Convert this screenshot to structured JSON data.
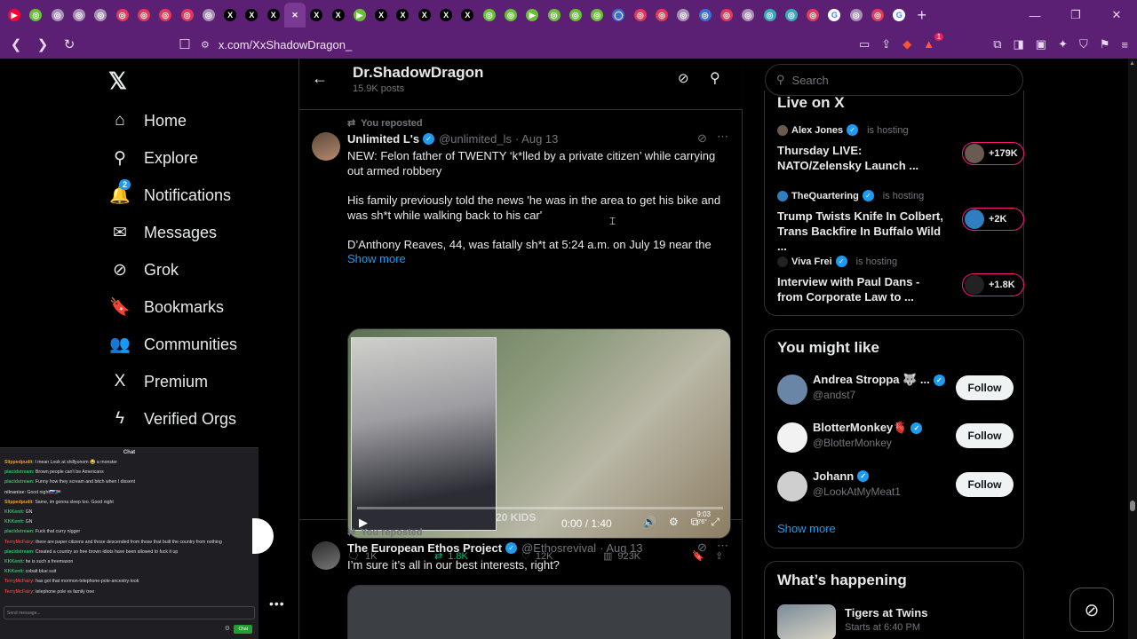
{
  "browser": {
    "tab_favicons": [
      {
        "icon": "youtube-icon",
        "color": "#ff0033",
        "glyph": "▶"
      },
      {
        "icon": "chromium-green-icon",
        "color": "#6abf38",
        "glyph": "◎"
      },
      {
        "icon": "site-gray-icon",
        "color": "#a890b4",
        "glyph": "◎"
      },
      {
        "icon": "site-gray-icon",
        "color": "#a890b4",
        "glyph": "◎"
      },
      {
        "icon": "site-gray-icon",
        "color": "#a890b4",
        "glyph": "◎"
      },
      {
        "icon": "site-red-icon",
        "color": "#e03a5a",
        "glyph": "◎"
      },
      {
        "icon": "site-red-icon",
        "color": "#e03a5a",
        "glyph": "◎"
      },
      {
        "icon": "site-red-icon",
        "color": "#e03a5a",
        "glyph": "◎"
      },
      {
        "icon": "site-red-icon",
        "color": "#e03a5a",
        "glyph": "◎"
      },
      {
        "icon": "site-gray-icon",
        "color": "#a890b4",
        "glyph": "◎"
      },
      {
        "icon": "x-icon",
        "color": "#000000",
        "glyph": "X"
      },
      {
        "icon": "x-icon",
        "color": "#000000",
        "glyph": "X"
      },
      {
        "icon": "x-icon",
        "color": "#000000",
        "glyph": "X"
      },
      {
        "icon": "close-tab-icon",
        "color": "#7a3a93",
        "glyph": "✕"
      },
      {
        "icon": "x-icon",
        "color": "#000000",
        "glyph": "X"
      },
      {
        "icon": "x-icon",
        "color": "#000000",
        "glyph": "X"
      },
      {
        "icon": "rumble-icon",
        "color": "#6abf38",
        "glyph": "▶"
      },
      {
        "icon": "x-icon",
        "color": "#000000",
        "glyph": "X"
      },
      {
        "icon": "x-icon",
        "color": "#000000",
        "glyph": "X"
      },
      {
        "icon": "x-icon",
        "color": "#000000",
        "glyph": "X"
      },
      {
        "icon": "x-icon",
        "color": "#000000",
        "glyph": "X"
      },
      {
        "icon": "x-icon",
        "color": "#000000",
        "glyph": "X"
      },
      {
        "icon": "chromium-green-icon",
        "color": "#6abf38",
        "glyph": "◎"
      },
      {
        "icon": "chromium-green-icon",
        "color": "#6abf38",
        "glyph": "◎"
      },
      {
        "icon": "rumble-icon",
        "color": "#6abf38",
        "glyph": "▶"
      },
      {
        "icon": "chromium-green-icon",
        "color": "#6abf38",
        "glyph": "◎"
      },
      {
        "icon": "chromium-green-icon",
        "color": "#6abf38",
        "glyph": "◎"
      },
      {
        "icon": "chromium-green-icon",
        "color": "#6abf38",
        "glyph": "◎"
      },
      {
        "icon": "site-blue-icon",
        "color": "#3b6fd8",
        "glyph": "◯"
      },
      {
        "icon": "site-red-icon",
        "color": "#e03a5a",
        "glyph": "◎"
      },
      {
        "icon": "site-red-icon",
        "color": "#e03a5a",
        "glyph": "◎"
      },
      {
        "icon": "site-gray-icon",
        "color": "#a890b4",
        "glyph": "◎"
      },
      {
        "icon": "site-blue-icon",
        "color": "#3b6fd8",
        "glyph": "◎"
      },
      {
        "icon": "site-red-icon",
        "color": "#e03a5a",
        "glyph": "◎"
      },
      {
        "icon": "site-gray-icon",
        "color": "#a890b4",
        "glyph": "◎"
      },
      {
        "icon": "site-teal-icon",
        "color": "#3aa8b8",
        "glyph": "◎"
      },
      {
        "icon": "site-teal-icon",
        "color": "#3aa8b8",
        "glyph": "◎"
      },
      {
        "icon": "site-red-icon",
        "color": "#e03a5a",
        "glyph": "◎"
      },
      {
        "icon": "google-icon",
        "color": "#ffffff",
        "glyph": "G"
      },
      {
        "icon": "site-gray-icon",
        "color": "#a890b4",
        "glyph": "◎"
      },
      {
        "icon": "site-red-icon",
        "color": "#e03a5a",
        "glyph": "◎"
      },
      {
        "icon": "google-icon",
        "color": "#ffffff",
        "glyph": "G"
      }
    ],
    "active_tab_index": 13,
    "url": "x.com/XxShadowDragon_",
    "extension_count": "1"
  },
  "nav": {
    "items": [
      {
        "label": "Home",
        "icon": "home-icon",
        "glyph": "⌂"
      },
      {
        "label": "Explore",
        "icon": "search-icon",
        "glyph": "⚲"
      },
      {
        "label": "Notifications",
        "icon": "bell-icon",
        "glyph": "🔔"
      },
      {
        "label": "Messages",
        "icon": "mail-icon",
        "glyph": "✉"
      },
      {
        "label": "Grok",
        "icon": "grok-icon",
        "glyph": "⊘"
      },
      {
        "label": "Bookmarks",
        "icon": "bookmark-icon",
        "glyph": "🔖"
      },
      {
        "label": "Communities",
        "icon": "communities-icon",
        "glyph": "👥"
      },
      {
        "label": "Premium",
        "icon": "x-icon",
        "glyph": "X"
      },
      {
        "label": "Verified Orgs",
        "icon": "bolt-icon",
        "glyph": "ϟ"
      }
    ],
    "notification_count": "2"
  },
  "chat": {
    "title": "Chat",
    "lines": [
      {
        "user": "Slippedpudit",
        "color": "#e8a020",
        "text": "I mean Look at shillyonom 😂 a monster"
      },
      {
        "user": "placidstream",
        "color": "#22c55e",
        "text": "Brown people can't be Americans"
      },
      {
        "user": "placidstream",
        "color": "#22c55e",
        "text": "Funny how they scream and bitch when I dissent"
      },
      {
        "user": "nilnanise",
        "color": "#bbbbbb",
        "text": "Good night🇷🇺🇿🇦"
      },
      {
        "user": "Slippedpudit",
        "color": "#e8a020",
        "text": "Same, im gonna sleep too. Good night"
      },
      {
        "user": "KKKentt",
        "color": "#22c55e",
        "text": "GN"
      },
      {
        "user": "KKKentt",
        "color": "#22c55e",
        "text": "GN"
      },
      {
        "user": "placidstream",
        "color": "#22c55e",
        "text": "Fuck that curry nigger"
      },
      {
        "user": "TerryMcFairy",
        "color": "#e03a3a",
        "text": "there are paper citizens and those descended from those that built the country from nothing"
      },
      {
        "user": "placidstream",
        "color": "#22c55e",
        "text": "Created a country so free brown idiots have been allowed to fuck it up"
      },
      {
        "user": "KKKentt",
        "color": "#22c55e",
        "text": "he is such a freemason"
      },
      {
        "user": "KKKentt",
        "color": "#22c55e",
        "text": "cobalt blue suit"
      },
      {
        "user": "TerryMcFairy",
        "color": "#e03a3a",
        "text": "has got that mormon-telephone-pole-ancestry-look"
      },
      {
        "user": "TerryMcFairy",
        "color": "#e03a3a",
        "text": "telephone pole vs family tree"
      }
    ],
    "input_placeholder": "Send message...",
    "send_label": "Chat"
  },
  "profile_header": {
    "name": "Dr.ShadowDragon",
    "posts": "15.9K posts"
  },
  "tweets": [
    {
      "repost_label": "You reposted",
      "name": "Unlimited L's",
      "handle": "@unlimited_ls",
      "date": "· Aug 13",
      "text_blocks": [
        "NEW: Felon father of TWENTY ‘k*lled by a private citizen’ while carrying out armed robbery",
        "His family previously told the news 'he was in the area to get his bike and was sh*t while walking back to his car'",
        "D’Anthony Reaves, 44, was fatally sh*t at 5:24 a.m. on July 19 near the"
      ],
      "show_more": "Show more",
      "video": {
        "overlay_text": "20 KIDS",
        "time": "0:00 / 1:40",
        "clock": "9:03",
        "temp": "76°"
      },
      "actions": {
        "replies": "1K",
        "reposts": "1.8K",
        "likes": "12K",
        "views": "923K"
      }
    },
    {
      "repost_label": "You reposted",
      "name": "The European Ethos Project",
      "handle": "@Ethosrevival",
      "date": "· Aug 13",
      "text": "I’m sure it’s all in our best interests, right?"
    }
  ],
  "sidebar": {
    "search_placeholder": "Search",
    "live_title": "Live on X",
    "live": [
      {
        "host": "Alex Jones",
        "hosting": "is hosting",
        "title": "Thursday LIVE: NATO/Zelensky Launch ...",
        "count": "+179K"
      },
      {
        "host": "TheQuartering",
        "hosting": "is hosting",
        "title": "Trump Twists Knife In Colbert, Trans Backfire In Buffalo Wild ...",
        "count": "+2K"
      },
      {
        "host": "Viva Frei",
        "hosting": "is hosting",
        "title": "Interview with Paul Dans - from Corporate Law to ...",
        "count": "+1.8K"
      }
    ],
    "might_like_title": "You might like",
    "suggestions": [
      {
        "name": "Andrea Stroppa 🐺 ...",
        "handle": "@andst7",
        "follow": "Follow"
      },
      {
        "name": "BlotterMonkey🫀",
        "handle": "@BlotterMonkey",
        "follow": "Follow"
      },
      {
        "name": "Johann",
        "handle": "@LookAtMyMeat1",
        "follow": "Follow"
      }
    ],
    "show_more": "Show more",
    "happening_title": "What’s happening",
    "trend": {
      "title": "Tigers at Twins",
      "sub": "Starts at 6:40 PM"
    }
  },
  "colors": {
    "accent": "#1d9bf0",
    "repost": "#00ba7c",
    "live_ring": "#f91880",
    "browser_chrome": "#5b1f73"
  }
}
